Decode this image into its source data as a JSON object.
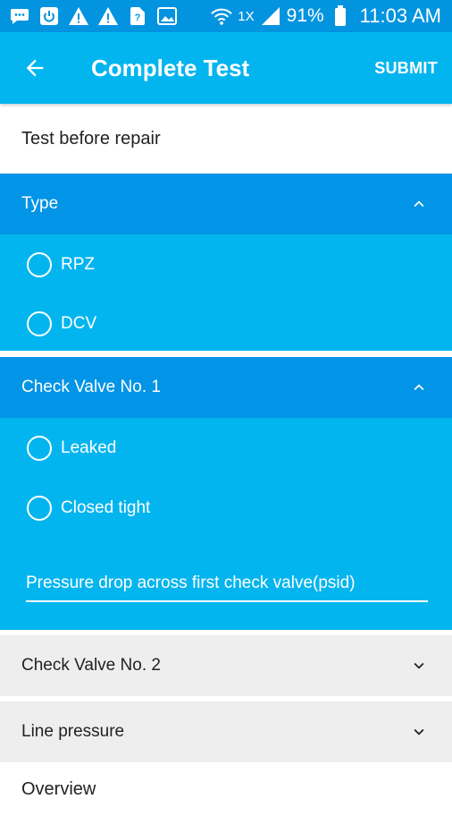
{
  "status_bar": {
    "icons": [
      "message-icon",
      "power-icon",
      "warning-icon",
      "warning-icon",
      "sim-question-icon",
      "image-icon",
      "wifi-icon",
      "signal-icon",
      "battery-icon"
    ],
    "network": "1X",
    "battery": "91%",
    "time": "11:03 AM"
  },
  "app_bar": {
    "title": "Complete Test",
    "submit_label": "SUBMIT"
  },
  "subtitle": "Test before repair",
  "sections": {
    "type": {
      "label": "Type",
      "options": [
        "RPZ",
        "DCV"
      ]
    },
    "check_valve_1": {
      "label": "Check Valve No. 1",
      "options": [
        "Leaked",
        "Closed tight"
      ],
      "input_placeholder": "Pressure drop across first check valve(psid)"
    },
    "check_valve_2": {
      "label": "Check Valve No. 2"
    },
    "line_pressure": {
      "label": "Line pressure"
    },
    "overview": {
      "label": "Overview"
    }
  },
  "colors": {
    "status_bar": "#0394e0",
    "app_bar": "#03b5ef",
    "section_header": "#0294e6",
    "section_body": "#03b5ef",
    "collapsed_header": "#eeeeee"
  }
}
